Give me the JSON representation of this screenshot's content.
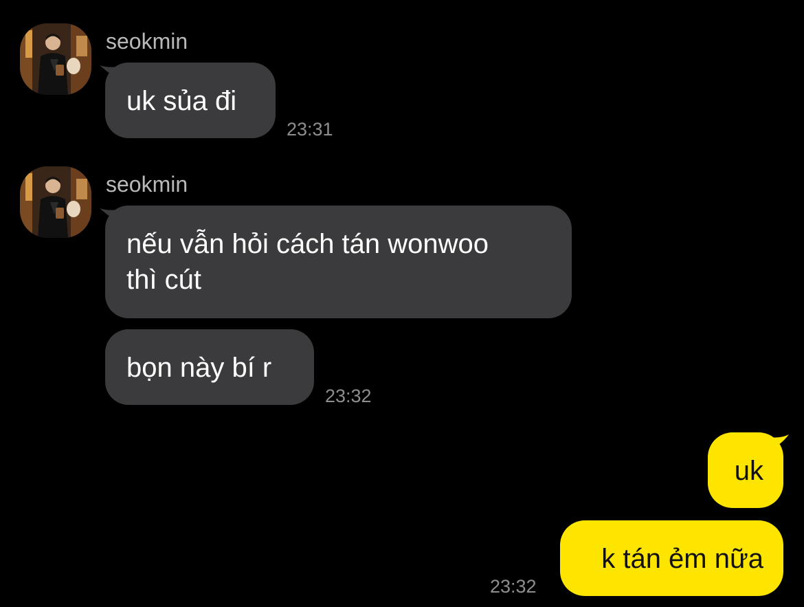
{
  "colors": {
    "background": "#000000",
    "incoming_bubble": "#3b3b3d",
    "outgoing_bubble": "#fee500",
    "sender_name": "#b9b9b9",
    "timestamp": "#8e8e8e"
  },
  "groups": [
    {
      "sender": "seokmin",
      "messages": [
        "uk sủa đi"
      ],
      "time": "23:31"
    },
    {
      "sender": "seokmin",
      "messages": [
        "nếu vẫn hỏi cách tán wonwoo\nthì cút",
        "bọn này bí r"
      ],
      "time": "23:32"
    }
  ],
  "outgoing": {
    "messages": [
      "uk",
      "k tán ẻm nữa"
    ],
    "time": "23:32"
  }
}
